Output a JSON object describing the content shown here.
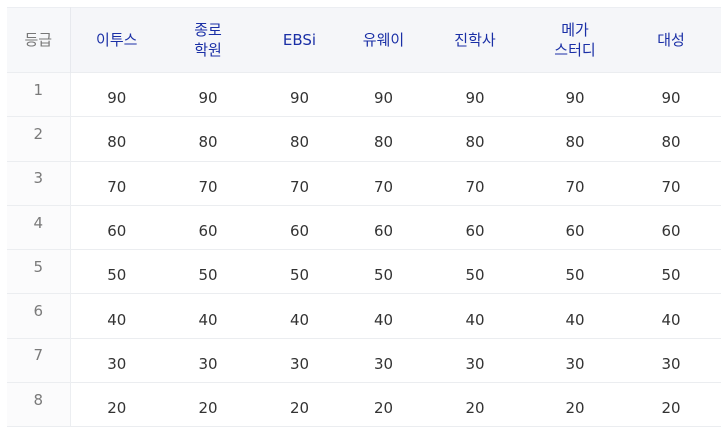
{
  "table": {
    "grade_header": "등급",
    "columns": [
      {
        "lines": [
          "이투스"
        ]
      },
      {
        "lines": [
          "종로",
          "학원"
        ]
      },
      {
        "lines": [
          "EBSi"
        ]
      },
      {
        "lines": [
          "유웨이"
        ]
      },
      {
        "lines": [
          "진학사"
        ]
      },
      {
        "lines": [
          "메가",
          "스터디"
        ]
      },
      {
        "lines": [
          "대성"
        ]
      }
    ],
    "rows": [
      {
        "grade": "1",
        "values": [
          "90",
          "90",
          "90",
          "90",
          "90",
          "90",
          "90"
        ]
      },
      {
        "grade": "2",
        "values": [
          "80",
          "80",
          "80",
          "80",
          "80",
          "80",
          "80"
        ]
      },
      {
        "grade": "3",
        "values": [
          "70",
          "70",
          "70",
          "70",
          "70",
          "70",
          "70"
        ]
      },
      {
        "grade": "4",
        "values": [
          "60",
          "60",
          "60",
          "60",
          "60",
          "60",
          "60"
        ]
      },
      {
        "grade": "5",
        "values": [
          "50",
          "50",
          "50",
          "50",
          "50",
          "50",
          "50"
        ]
      },
      {
        "grade": "6",
        "values": [
          "40",
          "40",
          "40",
          "40",
          "40",
          "40",
          "40"
        ]
      },
      {
        "grade": "7",
        "values": [
          "30",
          "30",
          "30",
          "30",
          "30",
          "30",
          "30"
        ]
      },
      {
        "grade": "8",
        "values": [
          "20",
          "20",
          "20",
          "20",
          "20",
          "20",
          "20"
        ]
      }
    ]
  },
  "colors": {
    "header_text": "#1a2fa6",
    "header_bg": "#f5f6f9",
    "grade_text": "#7a7a7a",
    "cell_text": "#333333",
    "row_border": "#ebedf0"
  }
}
